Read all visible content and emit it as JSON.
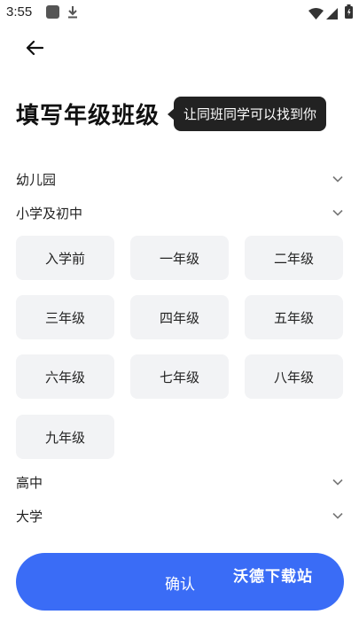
{
  "status_bar": {
    "time": "3:55",
    "icons": [
      "media-icon",
      "download-icon",
      "wifi-icon",
      "signal-icon",
      "battery-icon"
    ]
  },
  "header": {
    "back_icon": "arrow-left-icon",
    "title": "填写年级班级",
    "tooltip": "让同班同学可以找到你"
  },
  "sections": [
    {
      "label": "幼儿园",
      "icon": "chevron-down-icon"
    },
    {
      "label": "小学及初中",
      "icon": "chevron-down-icon"
    },
    {
      "label": "高中",
      "icon": "chevron-down-icon"
    },
    {
      "label": "大学",
      "icon": "chevron-down-icon"
    }
  ],
  "grades": [
    "入学前",
    "一年级",
    "二年级",
    "三年级",
    "四年级",
    "五年级",
    "六年级",
    "七年级",
    "八年级",
    "九年级"
  ],
  "footer": {
    "confirm_label": "确认",
    "watermark": "沃德下载站"
  },
  "colors": {
    "accent": "#3a6cf6",
    "tooltip_bg": "#222222",
    "grade_bg": "#f2f3f5"
  }
}
